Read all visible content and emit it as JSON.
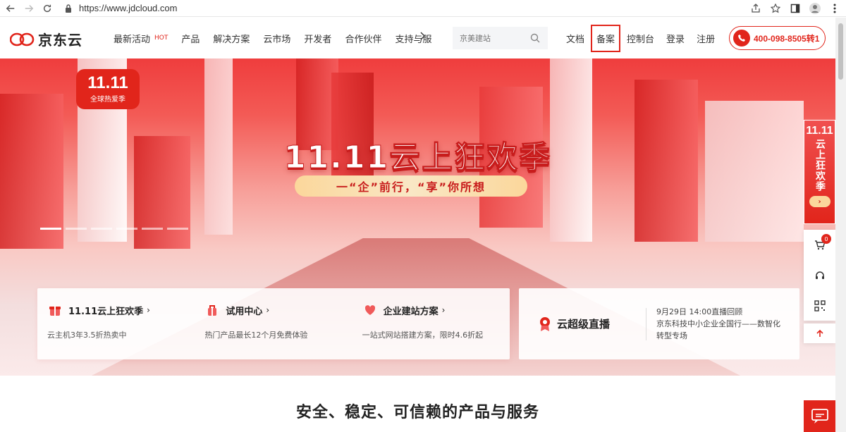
{
  "browser": {
    "url": "https://www.jdcloud.com"
  },
  "header": {
    "logo_text": "京东云",
    "nav": [
      {
        "label": "最新活动",
        "badge": "HOT"
      },
      {
        "label": "产品"
      },
      {
        "label": "解决方案"
      },
      {
        "label": "云市场"
      },
      {
        "label": "开发者"
      },
      {
        "label": "合作伙伴"
      },
      {
        "label": "支持与服"
      }
    ],
    "search_placeholder": "京美建站",
    "right_nav": [
      "文档",
      "备案",
      "控制台",
      "登录",
      "注册"
    ],
    "phone": "400-098-8505转1"
  },
  "hero": {
    "badge_number": "11.11",
    "badge_text": "全球热爱季",
    "title": "11.11云上狂欢季",
    "subtitle": "一“企”前行，“享”你所想"
  },
  "promos": [
    {
      "title": "11.11云上狂欢季",
      "desc": "云主机3年3.5折热卖中",
      "icon": "gift-icon"
    },
    {
      "title": "试用中心",
      "desc": "热门产品最长12个月免费体验",
      "icon": "trial-icon"
    },
    {
      "title": "企业建站方案",
      "desc": "一站式网站搭建方案，限时4.6折起",
      "icon": "heart-icon"
    }
  ],
  "live": {
    "title": "云超级直播",
    "date_line": "9月29日 14:00直播回顾",
    "desc": "京东科技中小企业全国行——数智化转型专场"
  },
  "side": {
    "promo_number": "11.11",
    "promo_text": "云上狂欢季",
    "cart_count": "0"
  },
  "section_title": "安全、稳定、可信赖的产品与服务",
  "colors": {
    "brand_red": "#e1251b"
  }
}
